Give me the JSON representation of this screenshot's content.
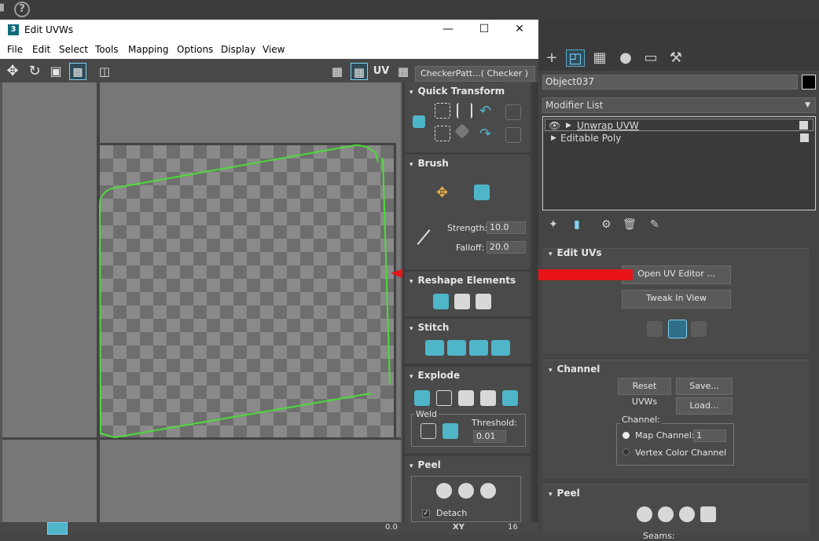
{
  "main": {
    "help_glyph": "?",
    "object_name": "Object037",
    "modifier_list_label": "Modifier List",
    "stack": [
      {
        "label": "Unwrap UVW"
      },
      {
        "label": "Editable Poly"
      }
    ],
    "edit_uvs": {
      "title": "Edit UVs",
      "open_uv_editor": "Open UV Editor ...",
      "tweak_in_view": "Tweak In View"
    },
    "channel": {
      "title": "Channel",
      "reset_uvws": "Reset UVWs",
      "save": "Save...",
      "load": "Load...",
      "group_label": "Channel:",
      "map_channel_label": "Map Channel:",
      "map_channel_value": "1",
      "vertex_color_channel_label": "Vertex Color Channel"
    },
    "peel": {
      "title": "Peel",
      "seams_label": "Seams:"
    }
  },
  "uvw_window": {
    "app_icon": "3",
    "title": "Edit UVWs",
    "menu": [
      "File",
      "Edit",
      "Select",
      "Tools",
      "Mapping",
      "Options",
      "Display",
      "View"
    ],
    "uv_label": "UV",
    "checker_dropdown": "CheckerPatt...( Checker )",
    "panel": {
      "quick_transform": {
        "title": "Quick Transform"
      },
      "brush": {
        "title": "Brush",
        "strength_label": "Strength:",
        "strength_value": "10.0",
        "falloff_label": "Falloff:",
        "falloff_value": "20.0"
      },
      "reshape": {
        "title": "Reshape Elements"
      },
      "stitch": {
        "title": "Stitch"
      },
      "explode": {
        "title": "Explode",
        "weld_label": "Weld",
        "threshold_label": "Threshold:",
        "threshold_value": "0.01"
      },
      "peel": {
        "title": "Peel",
        "detach_label": "Detach",
        "detach_checked": true
      }
    },
    "bottom": {
      "field1": "0.0",
      "xy": "XY",
      "zoom": "16"
    }
  },
  "colors": {
    "uv_edge": "#4ddb3a",
    "arrow": "#e8141a",
    "accent_teal": "#2f9aae"
  }
}
